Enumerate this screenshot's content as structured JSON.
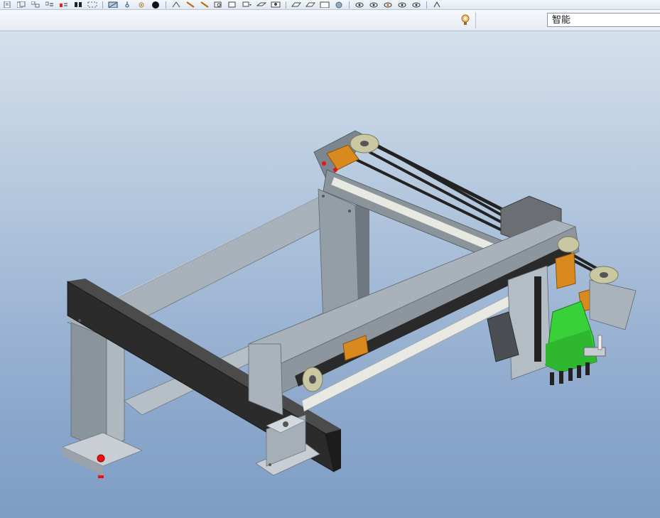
{
  "toolbar": {
    "icons": [
      "page-icon",
      "page-layers-icon",
      "layers-icon",
      "list-icon",
      "list-red-icon",
      "columns-icon",
      "dashed-box-icon",
      "view-icon",
      "pin-icon",
      "spin-icon",
      "shade-icon",
      "sketch-icon",
      "line-icon",
      "pencil-icon",
      "zoom-box-icon",
      "rect-select-icon",
      "select-arrow-icon",
      "link-icon",
      "annotation-icon",
      "annotation-2-icon",
      "annotation-3-icon",
      "active-view-icon",
      "sphere-icon",
      "eye-icon",
      "eye-2-icon",
      "eye-3-icon",
      "eye-4-icon",
      "eye-5-icon",
      "arrow-icon"
    ]
  },
  "secondbar": {
    "filter_value": "智能",
    "display_icon": "bulb-icon"
  },
  "viewport": {
    "background_top": "#d5e0ec",
    "background_bottom": "#7f9dc4",
    "model_colors": {
      "frame": "#9aa5ae",
      "belt": "#2a2a2a",
      "rail": "#e9e9e4",
      "block": "#d98a1e",
      "head": "#39d139",
      "pulley": "#c9c8a2"
    }
  }
}
